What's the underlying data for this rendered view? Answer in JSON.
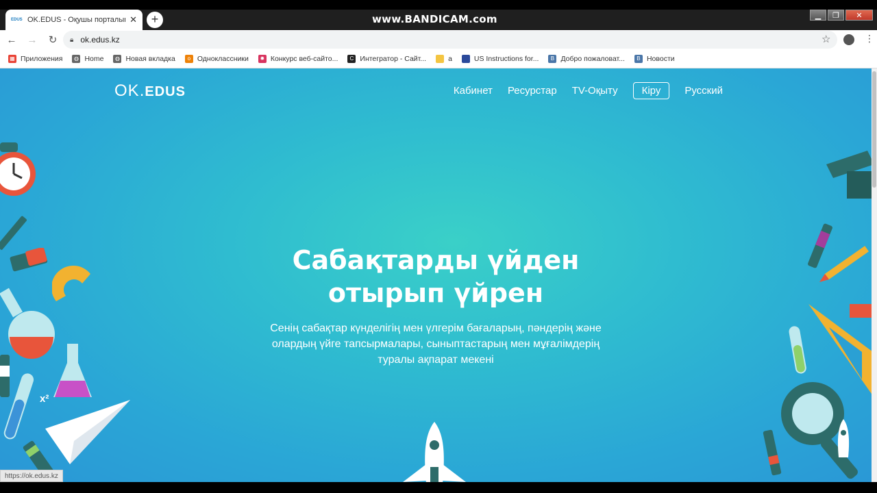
{
  "browser": {
    "tab_title": "OK.EDUS - Оқушы порталына к",
    "tab_favicon": "EDUS",
    "watermark": "www.BANDICAM.com",
    "url": "ok.edus.kz",
    "status_url": "https://ok.edus.kz"
  },
  "bookmarks": [
    {
      "label": "Приложения",
      "icon": "apps-grid-icon",
      "color": "#e94235"
    },
    {
      "label": "Home",
      "icon": "globe-icon",
      "color": "#666666"
    },
    {
      "label": "Новая вкладка",
      "icon": "globe-icon",
      "color": "#666666"
    },
    {
      "label": "Одноклассники",
      "icon": "odnoklassniki-icon",
      "color": "#ee8208"
    },
    {
      "label": "Конкурс веб-сайто...",
      "icon": "sparkle-icon",
      "color": "#d8345f"
    },
    {
      "label": "Интегратор - Сайт...",
      "icon": "circle-c-icon",
      "color": "#222222"
    },
    {
      "label": "а",
      "icon": "folder-icon",
      "color": "#f4c542"
    },
    {
      "label": "US Instructions for...",
      "icon": "us-flag-icon",
      "color": "#2b4a9b"
    },
    {
      "label": "Добро пожаловат...",
      "icon": "vk-icon",
      "color": "#4a76a8"
    },
    {
      "label": "Новости",
      "icon": "vk-icon",
      "color": "#4a76a8"
    }
  ],
  "site": {
    "logo_ok": "OK",
    "logo_edus": "EDUS",
    "nav": {
      "cabinet": "Кабинет",
      "resources": "Ресурстар",
      "tv": "TV-Оқыту",
      "login": "Кіру",
      "language": "Русский"
    },
    "hero_line1": "Сабақтарды үйден",
    "hero_line2": "отырып үйрен",
    "hero_sub": "Сенің сабақтар күнделігің мен үлгерім бағаларың, пәндерің және олардың үйге тапсырмалары, сыныптастарың мен мұғалімдерің туралы ақпарат мекені",
    "formula": "x²"
  }
}
